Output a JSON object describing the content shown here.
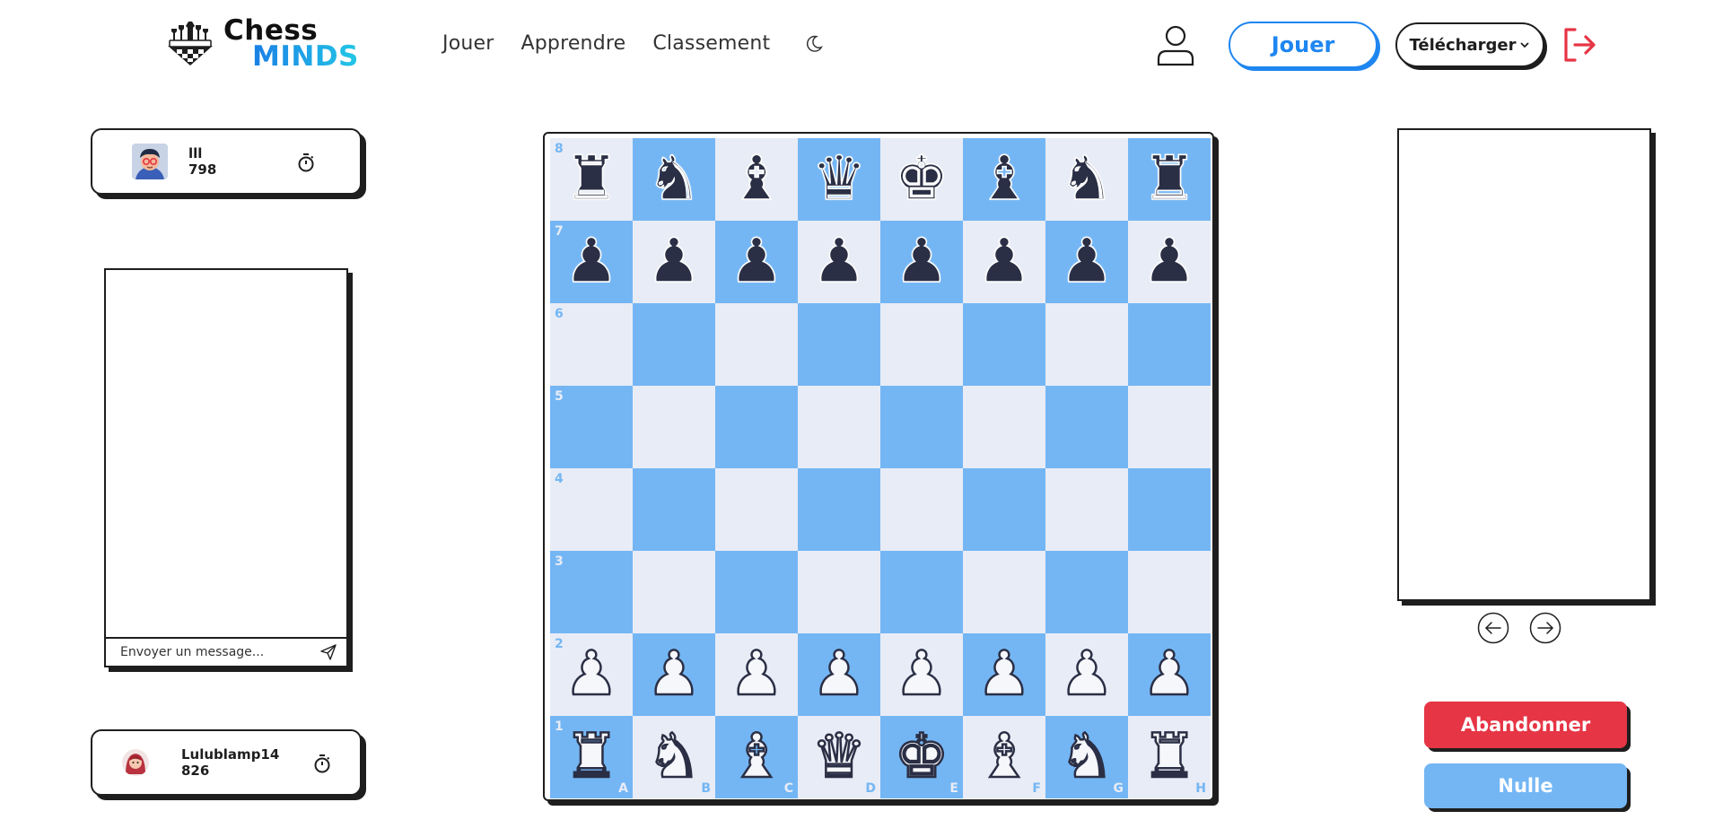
{
  "brand": {
    "line1": "Chess",
    "line2": "MINDS"
  },
  "nav": {
    "items": [
      "Jouer",
      "Apprendre",
      "Classement"
    ]
  },
  "header": {
    "play_label": "Jouer",
    "download_label": "Télécharger"
  },
  "opponent": {
    "name": "lll",
    "rating": "798"
  },
  "player": {
    "name": "Lulublamp14",
    "rating": "826"
  },
  "chat": {
    "placeholder": "Envoyer un message..."
  },
  "actions": {
    "resign_label": "Abandonner",
    "draw_label": "Nulle"
  },
  "board": {
    "files": [
      "A",
      "B",
      "C",
      "D",
      "E",
      "F",
      "G",
      "H"
    ],
    "ranks": [
      "8",
      "7",
      "6",
      "5",
      "4",
      "3",
      "2",
      "1"
    ],
    "light_color": "#e8ecf6",
    "dark_color": "#74b6f4",
    "position": [
      [
        "♜",
        "♞",
        "♝",
        "♛",
        "♚",
        "♝",
        "♞",
        "♜"
      ],
      [
        "♟",
        "♟",
        "♟",
        "♟",
        "♟",
        "♟",
        "♟",
        "♟"
      ],
      [
        "",
        "",
        "",
        "",
        "",
        "",
        "",
        ""
      ],
      [
        "",
        "",
        "",
        "",
        "",
        "",
        "",
        ""
      ],
      [
        "",
        "",
        "",
        "",
        "",
        "",
        "",
        ""
      ],
      [
        "",
        "",
        "",
        "",
        "",
        "",
        "",
        ""
      ],
      [
        "♟",
        "♟",
        "♟",
        "♟",
        "♟",
        "♟",
        "♟",
        "♟"
      ],
      [
        "♜",
        "♞",
        "♝",
        "♛",
        "♚",
        "♝",
        "♞",
        "♜"
      ]
    ],
    "piece_colors": [
      "b",
      "b",
      "",
      "",
      "",
      "",
      "w",
      "w"
    ]
  },
  "colors": {
    "accent": "#1e86f0",
    "danger": "#e63545",
    "board_dark": "#74b6f4"
  },
  "icons": [
    "logo-chess-icon",
    "moon-icon",
    "user-icon",
    "chevron-down-icon",
    "logout-icon",
    "timer-icon",
    "send-icon",
    "arrow-left-icon",
    "arrow-right-icon"
  ]
}
